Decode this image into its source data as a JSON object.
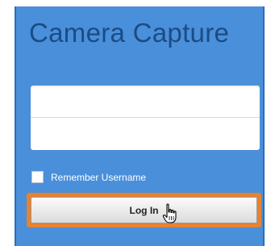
{
  "app": {
    "title": "Camera Capture"
  },
  "form": {
    "username": {
      "value": "",
      "placeholder": ""
    },
    "password": {
      "value": "",
      "placeholder": ""
    },
    "remember_label": "Remember Username",
    "remember_checked": false,
    "login_label": "Log In"
  },
  "colors": {
    "panel_bg": "#4a8fda",
    "title": "#1a4c85",
    "highlight": "#e7822f"
  },
  "cursor": {
    "icon": "hand-pointer-icon"
  }
}
